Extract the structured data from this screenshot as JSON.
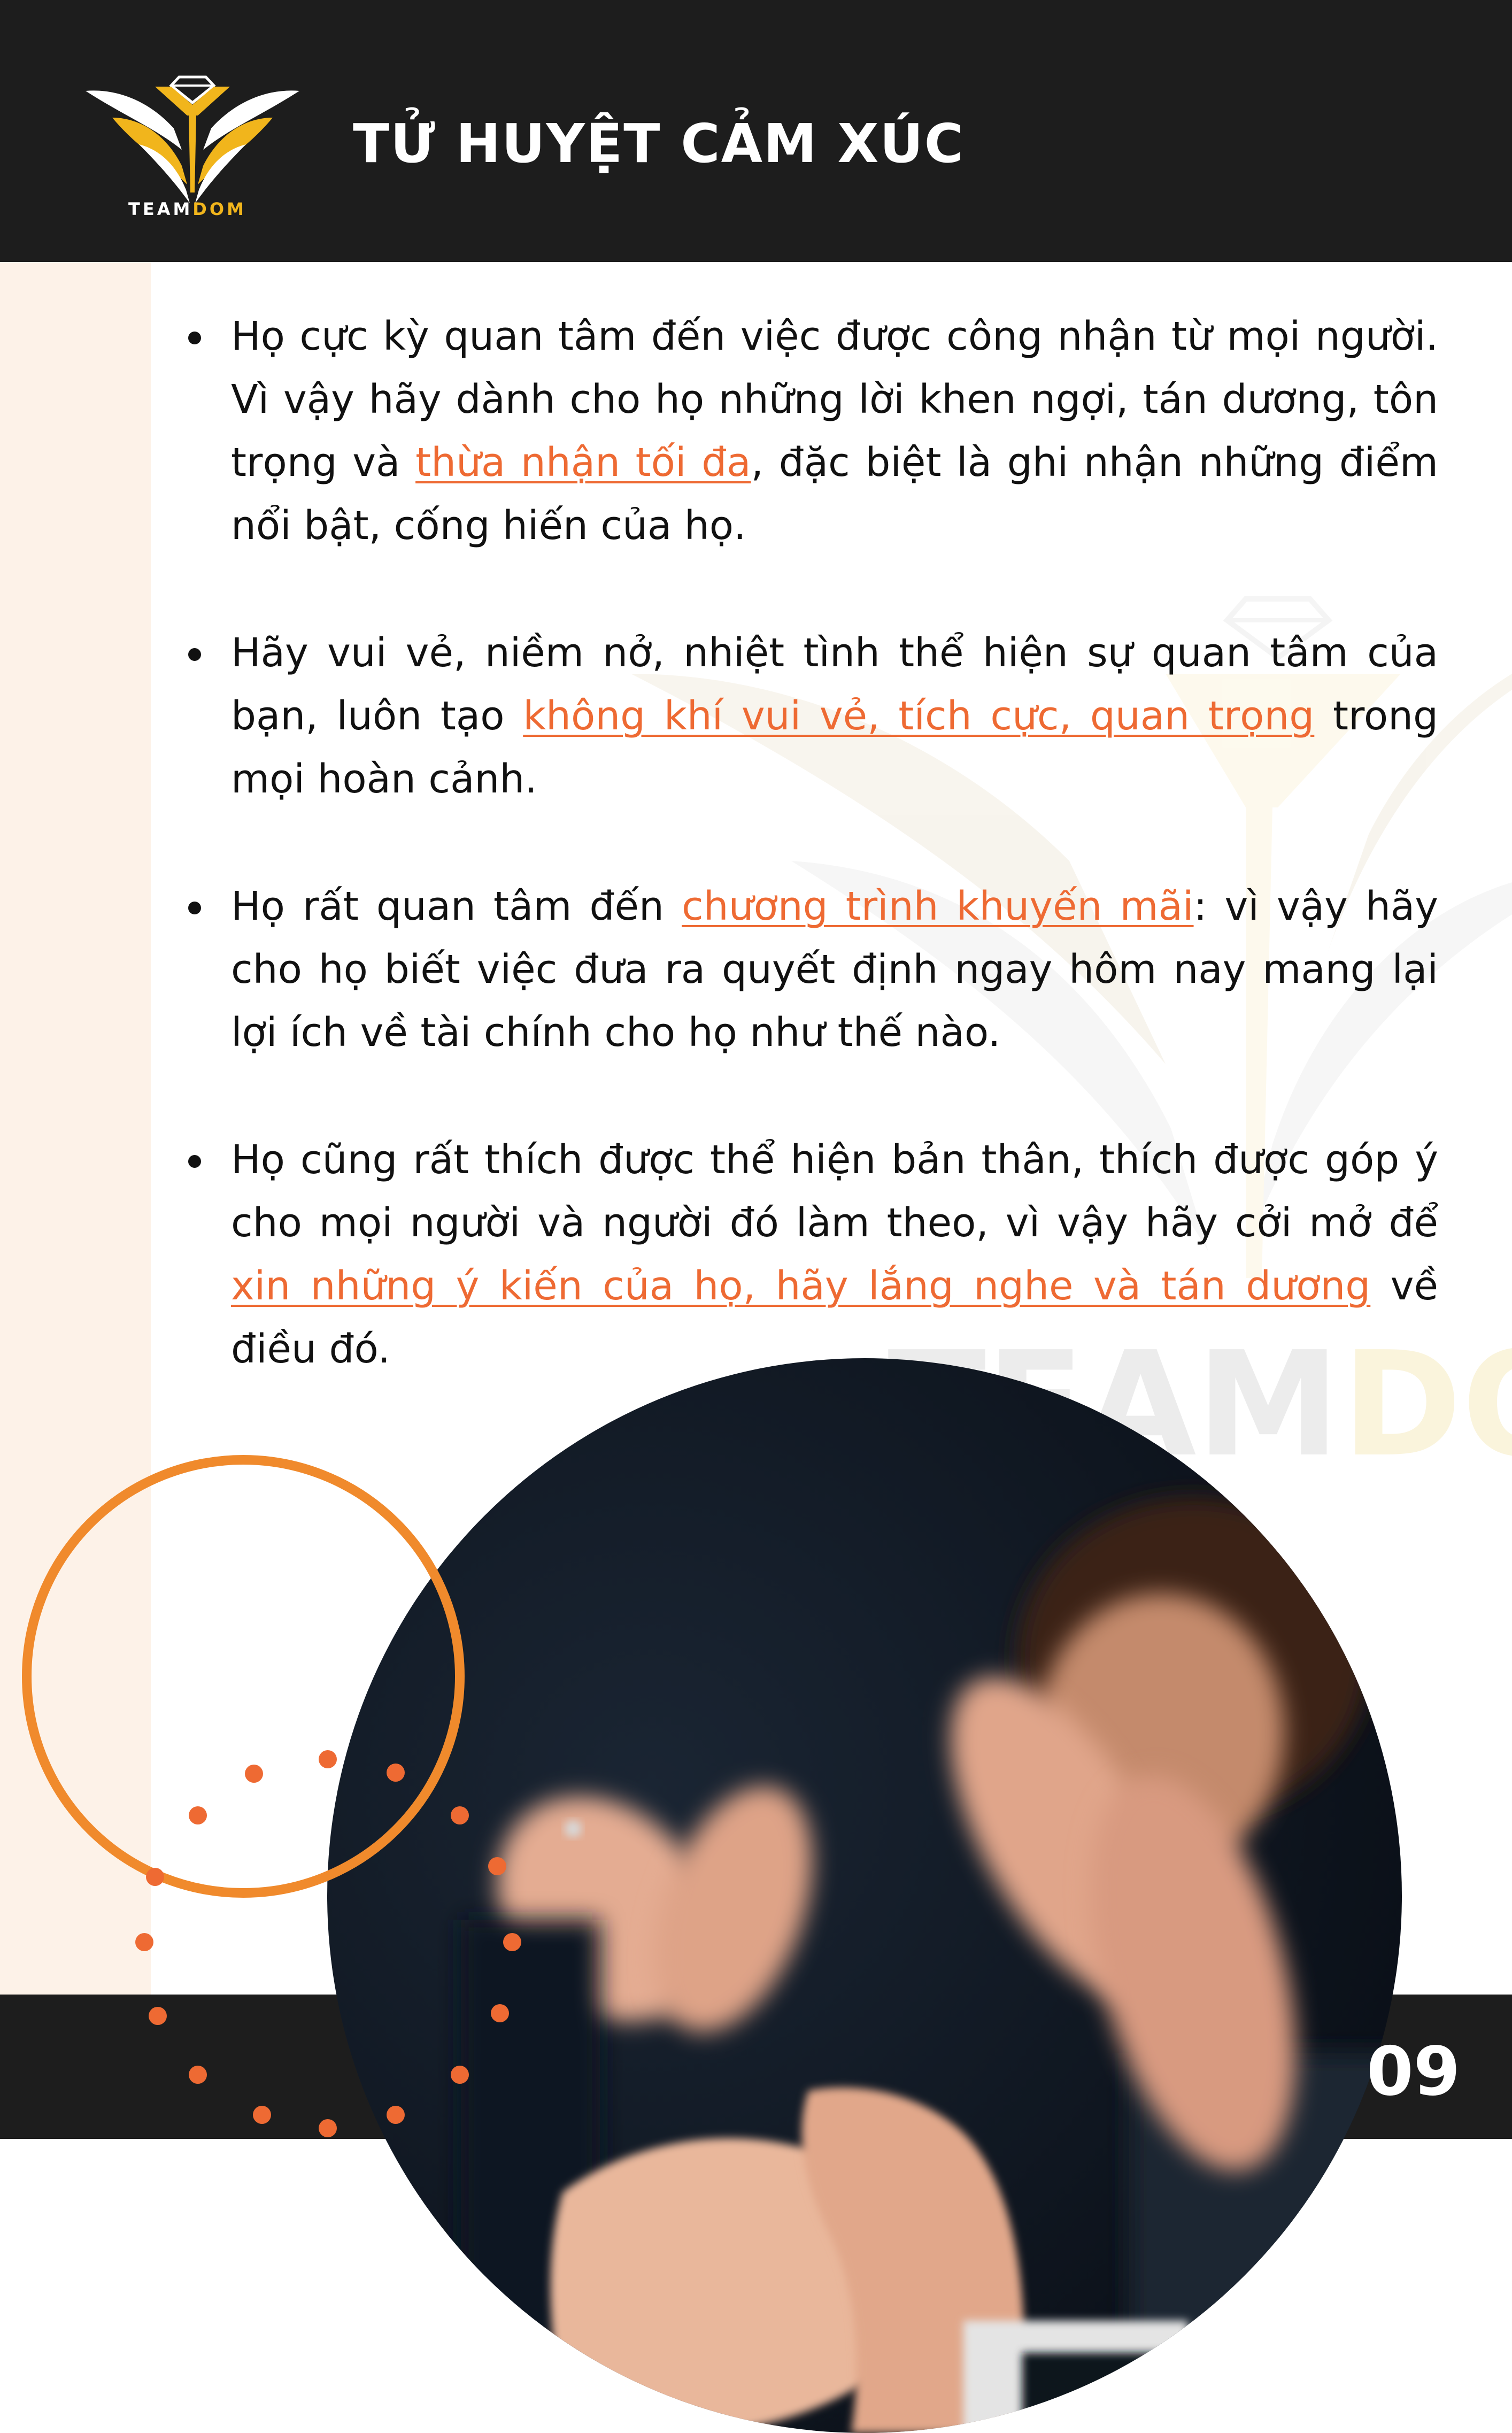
{
  "header": {
    "logo_text": "TEAM",
    "logo_text_accent": "DOM",
    "title": "TỬ HUYỆT CẢM XÚC"
  },
  "watermark": {
    "text": "TEAM",
    "text_accent": "DO"
  },
  "bullets": [
    {
      "text_before": "Họ cực kỳ quan tâm đến việc được công nhận từ mọi người. Vì vậy hãy dành cho họ những lời khen ngợi, tán dương, tôn trọng và ",
      "highlight": "thừa nhận tối đa",
      "text_after": ", đặc biệt là ghi nhận những điểm nổi bật, cống hiến của họ."
    },
    {
      "text_before": "Hãy vui vẻ, niềm nở, nhiệt tình thể hiện sự quan tâm của bạn, luôn tạo ",
      "highlight": "không khí vui vẻ, tích cực, quan trọng",
      "text_after": " trong mọi hoàn cảnh."
    },
    {
      "text_before": "Họ rất quan tâm đến ",
      "highlight": "chương trình khuyến mãi",
      "text_after": ": vì vậy hãy cho họ biết việc đưa ra quyết định ngay hôm nay mang lại lợi ích về tài chính cho họ như thế nào."
    },
    {
      "text_before": "Họ cũng rất thích được thể hiện bản thân, thích được góp ý cho mọi người và người đó làm theo, vì vậy hãy cởi mở để ",
      "highlight": "xin những ý kiến của họ, hãy lắng nghe và tán dương",
      "text_after": " về điều đó."
    }
  ],
  "footer": {
    "page_number": "09"
  },
  "colors": {
    "dark": "#1d1d1d",
    "accent_orange": "#ee6a33",
    "logo_gold": "#f1b51c",
    "cream": "#fdf2e8"
  },
  "icons": {
    "logo": "winged-diamond-logo",
    "photo": "clapping-hands-photo"
  }
}
